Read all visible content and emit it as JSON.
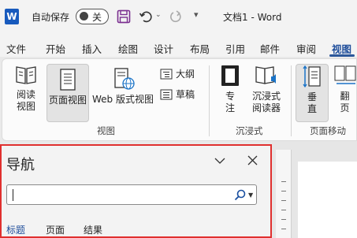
{
  "titlebar": {
    "logo": "W",
    "autosave_label": "自动保存",
    "autosave_state": "关",
    "doc_title": "文档1  -  Word",
    "icons": [
      "save-icon",
      "undo-icon",
      "redo-icon",
      "customize-quick-access-icon"
    ]
  },
  "tabs": [
    "文件",
    "开始",
    "插入",
    "绘图",
    "设计",
    "布局",
    "引用",
    "邮件",
    "审阅",
    "视图"
  ],
  "active_tab": "视图",
  "ribbon": {
    "view_group": {
      "read_mode": [
        "阅读",
        "视图"
      ],
      "print_layout": "页面视图",
      "web_layout": "Web 版式视图",
      "outline": "大纲",
      "draft": "草稿",
      "label": "视图"
    },
    "immersive_group": {
      "focus": [
        "专",
        "注"
      ],
      "immersive_reader": [
        "沉浸式",
        "阅读器"
      ],
      "label": "沉浸式"
    },
    "page_movement_group": {
      "vertical": [
        "垂",
        "直"
      ],
      "side_to_side": [
        "翻",
        "页"
      ],
      "label": "页面移动"
    }
  },
  "nav_pane": {
    "title": "导航",
    "search_value": "",
    "tabs": [
      "标题",
      "页面",
      "结果"
    ],
    "active_tab": "标题"
  },
  "colors": {
    "accent": "#2b579a",
    "highlight_border": "#e0302f",
    "save_icon": "#7a2e8f",
    "immersive_icon": "#1a73c7"
  }
}
